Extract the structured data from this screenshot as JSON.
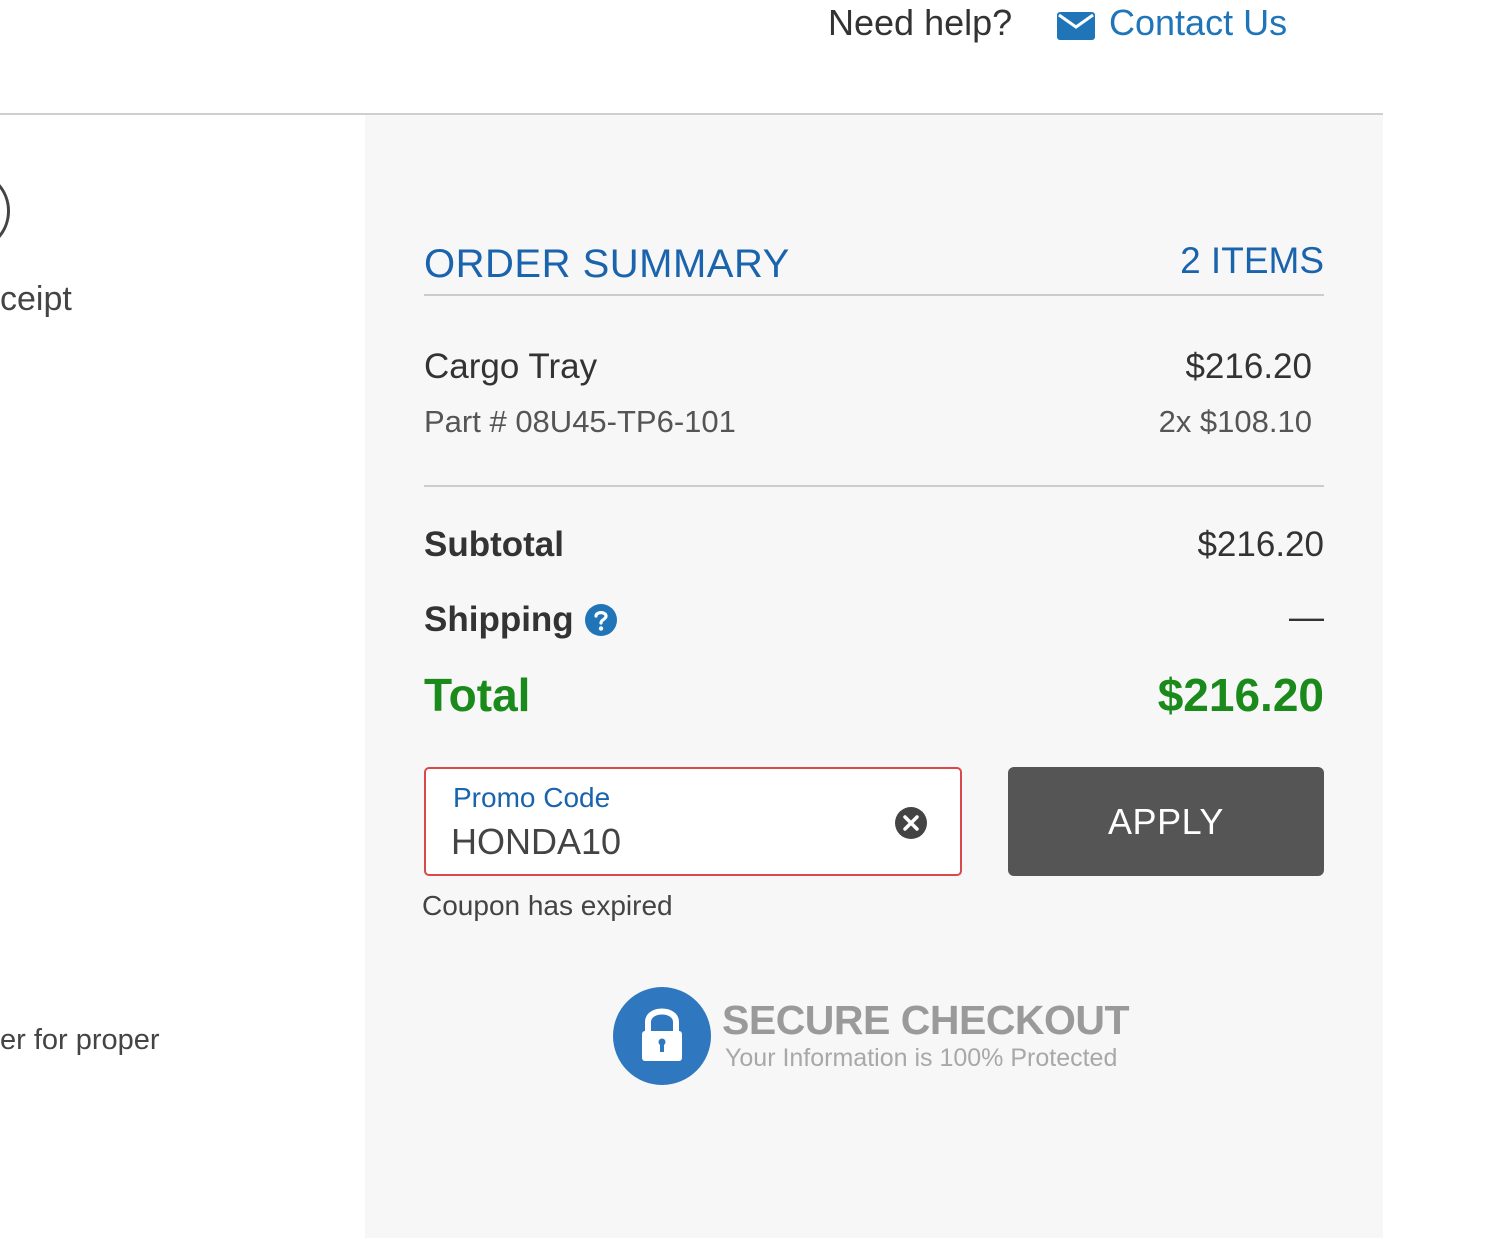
{
  "header": {
    "help_text": "Need help?",
    "contact_label": "Contact Us",
    "contact_icon": "envelope-icon"
  },
  "left_column": {
    "receipt_text": "ceipt",
    "note_text": "er for proper"
  },
  "summary": {
    "title": "ORDER SUMMARY",
    "item_count": "2 ITEMS",
    "items": [
      {
        "name": "Cargo Tray",
        "price": "$216.20",
        "part": "Part # 08U45-TP6-101",
        "qty_price": "2x $108.10"
      }
    ],
    "subtotal_label": "Subtotal",
    "subtotal_value": "$216.20",
    "shipping_label": "Shipping",
    "shipping_value": "—",
    "total_label": "Total",
    "total_value": "$216.20"
  },
  "promo": {
    "label": "Promo Code",
    "value": "HONDA10",
    "error": "Coupon has expired",
    "apply_label": "APPLY"
  },
  "secure": {
    "title": "SECURE CHECKOUT",
    "subtitle": "Your Information is 100% Protected"
  },
  "colors": {
    "accent_blue": "#1a63ad",
    "link_blue": "#1f75b8",
    "total_green": "#1a8a1a",
    "error_red": "#d9494c",
    "button_gray": "#555555",
    "panel_bg": "#f7f7f7"
  }
}
